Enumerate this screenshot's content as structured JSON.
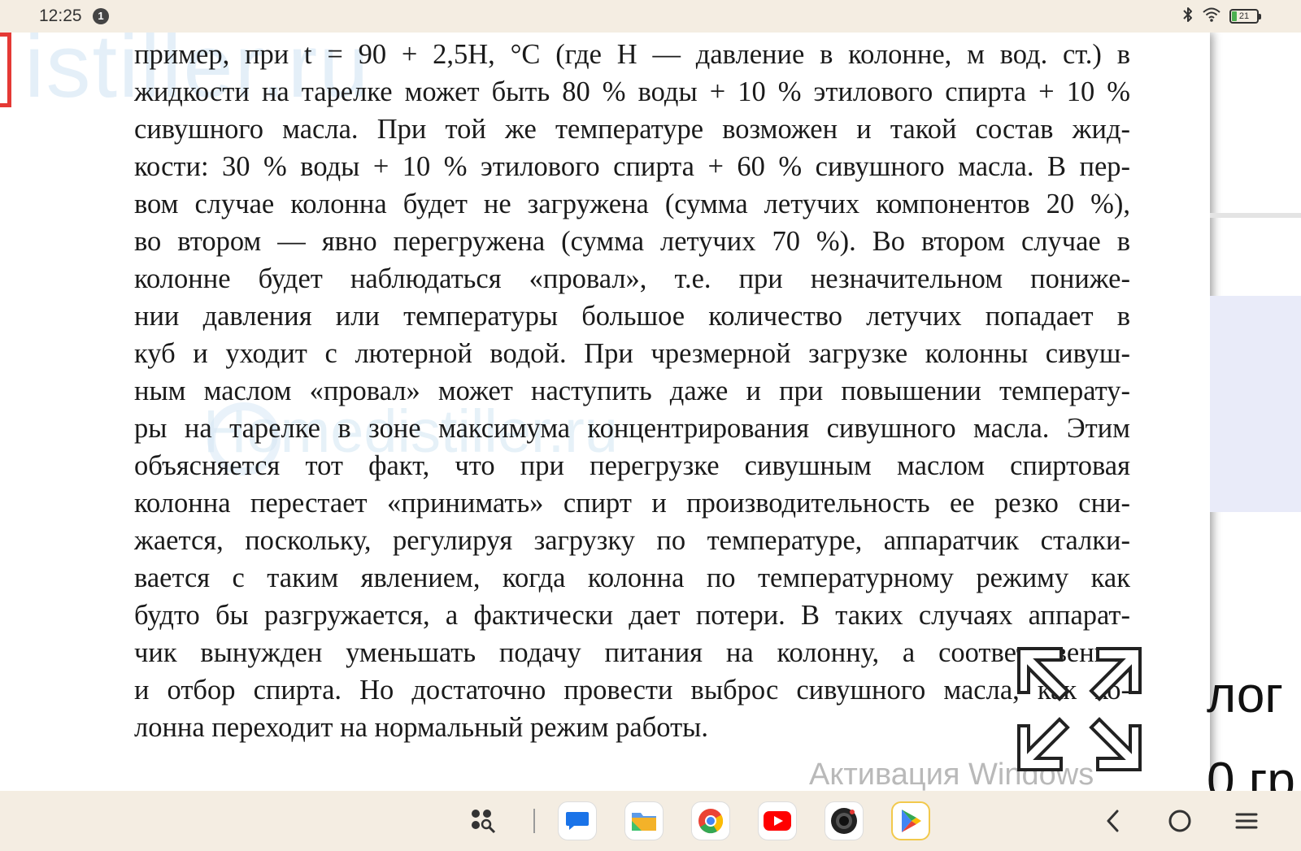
{
  "status_bar": {
    "time": "12:25",
    "notification_count": "1",
    "battery_level": "21",
    "battery_fraction": 0.21,
    "icons": [
      "bluetooth-icon",
      "wifi-icon",
      "battery-icon"
    ]
  },
  "document": {
    "watermark_top": "istiller.ru",
    "watermark_mid": "Homedistiller.ru",
    "lines": [
      "пример, при t = 90 + 2,5H, °C (где H — давление в колонне, м вод. ст.) в",
      "жидкости на тарелке может быть 80 % воды + 10 % этилового спирта + 10 %",
      "сивушного масла. При той же температуре возможен и такой состав жид-",
      "кости: 30 % воды + 10 % этилового спирта + 60 % сивушного масла. В пер-",
      "вом случае колонна будет не загружена (сумма летучих компонентов 20 %),",
      "во втором — явно перегружена (сумма летучих 70 %). Во втором случае в",
      "колонне будет наблюдаться «провал», т.е. при незначительном пониже-",
      "нии давления или температуры большое количество летучих попадает в",
      "куб и уходит с лютерной водой. При чрезмерной загрузке колонны сивуш-",
      "ным маслом «провал» может наступить даже и при повышении температу-",
      "ры на тарелке в зоне максимума концентрирования сивушного масла. Этим",
      "объясняется тот факт, что при перегрузке сивушным маслом спиртовая",
      "колонна перестает «принимать» спирт и производительность ее резко сни-",
      "жается, поскольку, регулируя загрузку по температуре, аппаратчик сталки-",
      "вается с таким явлением, когда колонна по температурному режиму как",
      "будто бы разгружается, а фактически дает потери. В таких случаях аппарат-",
      "чик вынужден уменьшать подачу питания на колонну, а соответственно,",
      "и отбор спирта. Но достаточно провести выброс сивушного масла, как ко-",
      "лонна переходит на нормальный режим работы."
    ],
    "activation_text": "Активация Windows"
  },
  "background_page": {
    "text_1": "лог",
    "text_2": "0 гр"
  },
  "dock": {
    "apps": [
      {
        "name": "app-drawer-icon",
        "color": "#333333"
      },
      {
        "name": "messages-icon",
        "color": "#1a73e8"
      },
      {
        "name": "files-icon",
        "color": "#5c9be8"
      },
      {
        "name": "chrome-icon",
        "color": "#ea4335"
      },
      {
        "name": "youtube-icon",
        "color": "#ff0000"
      },
      {
        "name": "camera-icon",
        "color": "#222222"
      },
      {
        "name": "play-store-icon",
        "color": "#34a853"
      }
    ]
  },
  "nav": {
    "icons": [
      "back-icon",
      "home-icon",
      "menu-icon"
    ]
  }
}
